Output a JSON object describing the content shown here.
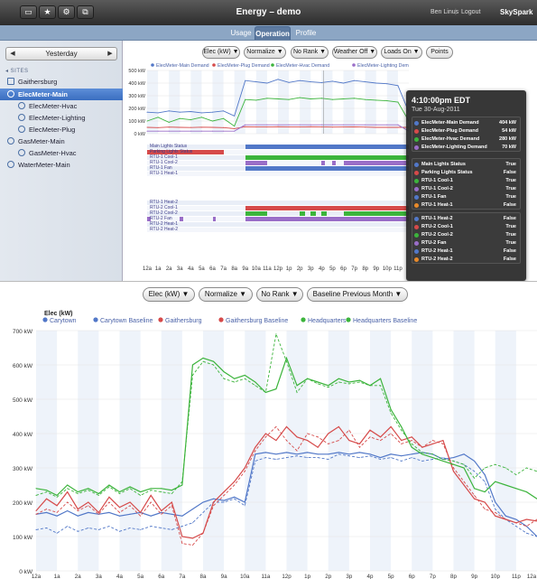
{
  "topbar": {
    "title": "Energy – demo",
    "user": "Ben Linus",
    "separator": "|",
    "logout": "Logout",
    "brand": "SkySpark",
    "icons": [
      "window-icon",
      "star-icon",
      "settings-icon",
      "copy-icon"
    ],
    "glyphs": [
      "▭",
      "★",
      "⚙",
      "⧉"
    ]
  },
  "tabs": [
    {
      "label": "Usage",
      "active": false
    },
    {
      "label": "Operation",
      "active": true
    },
    {
      "label": "Profile",
      "active": false
    }
  ],
  "sidebar": {
    "date": "Yesterday",
    "prev": "◀",
    "next": "▶",
    "sites_header": "◂ SITES",
    "items": [
      {
        "label": "Gaithersburg",
        "kind": "site",
        "level": 0,
        "selected": false
      },
      {
        "label": "ElecMeter-Main",
        "kind": "meter",
        "level": 0,
        "selected": true
      },
      {
        "label": "ElecMeter-Hvac",
        "kind": "meter",
        "level": 1,
        "selected": false
      },
      {
        "label": "ElecMeter-Lighting",
        "kind": "meter",
        "level": 1,
        "selected": false
      },
      {
        "label": "ElecMeter-Plug",
        "kind": "meter",
        "level": 1,
        "selected": false
      },
      {
        "label": "GasMeter-Main",
        "kind": "meter",
        "level": 0,
        "selected": false
      },
      {
        "label": "GasMeter-Hvac",
        "kind": "meter",
        "level": 1,
        "selected": false
      },
      {
        "label": "WaterMeter-Main",
        "kind": "meter",
        "level": 0,
        "selected": false
      }
    ]
  },
  "controls_top": [
    "Elec (kW) ▼",
    "Normalize ▼",
    "No Rank ▼",
    "Weather Off ▼",
    "Loads On ▼",
    "Points"
  ],
  "controls_main": [
    "Elec (kW) ▼",
    "Normalize ▼",
    "No Rank ▼",
    "Baseline Previous Month ▼"
  ],
  "colors": {
    "blue": "#5278c8",
    "red": "#d64a4a",
    "green": "#3cb43c",
    "purple": "#9a6ec8",
    "orange": "#e88a2a",
    "light_blue": "#9ab4e0",
    "light_red": "#e49a9a",
    "light_green": "#9ad89a"
  },
  "time_ticks": [
    "12a",
    "1a",
    "2a",
    "3a",
    "4a",
    "5a",
    "6a",
    "7a",
    "8a",
    "9a",
    "10a",
    "11a",
    "12p",
    "1p",
    "2p",
    "3p",
    "4p",
    "5p",
    "6p",
    "7p",
    "8p",
    "9p",
    "10p",
    "11p",
    "12a"
  ],
  "demand_chart": {
    "legend": [
      "ElecMeter-Main Demand",
      "ElecMeter-Plug Demand",
      "ElecMeter-Hvac Demand",
      "ElecMeter-Lighting Demand"
    ],
    "y_ticks": [
      "500 kW",
      "400 kW",
      "300 kW",
      "200 kW",
      "100 kW",
      "0 kW"
    ]
  },
  "status": {
    "group1": [
      {
        "label": "Main Lights Status",
        "color": "blue",
        "on": [
          [
            9,
            24
          ]
        ]
      },
      {
        "label": "Parking Lights Status",
        "color": "red",
        "on": [
          [
            0,
            7
          ]
        ]
      },
      {
        "label": "RTU-1 Cool-1",
        "color": "green",
        "on": [
          [
            9,
            24
          ]
        ]
      },
      {
        "label": "RTU-1 Cool-2",
        "color": "purple",
        "on": [
          [
            9,
            11
          ],
          [
            16,
            16.3
          ],
          [
            17,
            17.3
          ],
          [
            18,
            24
          ]
        ]
      },
      {
        "label": "RTU-1 Fan",
        "color": "blue",
        "on": [
          [
            9,
            24
          ]
        ]
      },
      {
        "label": "RTU-1 Heat-1",
        "color": "orange",
        "on": []
      }
    ],
    "group2": [
      {
        "label": "RTU-1 Heat-2",
        "color": "blue",
        "on": []
      },
      {
        "label": "RTU-2 Cool-1",
        "color": "red",
        "on": [
          [
            9,
            24
          ]
        ]
      },
      {
        "label": "RTU-2 Cool-2",
        "color": "green",
        "on": [
          [
            9,
            11
          ],
          [
            14,
            14.5
          ],
          [
            15,
            15.5
          ],
          [
            16,
            16.5
          ],
          [
            18,
            24
          ]
        ]
      },
      {
        "label": "RTU-2 Fan",
        "color": "purple",
        "on": [
          [
            0,
            0.3
          ],
          [
            3,
            3.3
          ],
          [
            6,
            6.3
          ],
          [
            9,
            24
          ]
        ]
      },
      {
        "label": "RTU-2 Heat-1",
        "color": "blue",
        "on": []
      },
      {
        "label": "RTU-2 Heat-2",
        "color": "orange",
        "on": []
      }
    ]
  },
  "tooltip": {
    "time": "4:10:00pm EDT",
    "date": "Tue 30-Aug-2011",
    "groups": [
      [
        {
          "label": "ElecMeter-Main Demand",
          "value": "404 kW",
          "color": "blue"
        },
        {
          "label": "ElecMeter-Plug Demand",
          "value": "54 kW",
          "color": "red"
        },
        {
          "label": "ElecMeter-Hvac Demand",
          "value": "280 kW",
          "color": "green"
        },
        {
          "label": "ElecMeter-Lighting Demand",
          "value": "70 kW",
          "color": "purple"
        }
      ],
      [
        {
          "label": "Main Lights Status",
          "value": "True",
          "color": "blue"
        },
        {
          "label": "Parking Lights Status",
          "value": "False",
          "color": "red"
        },
        {
          "label": "RTU-1 Cool-1",
          "value": "True",
          "color": "green"
        },
        {
          "label": "RTU-1 Cool-2",
          "value": "True",
          "color": "purple"
        },
        {
          "label": "RTU-1 Fan",
          "value": "True",
          "color": "blue"
        },
        {
          "label": "RTU-1 Heat-1",
          "value": "False",
          "color": "orange"
        }
      ],
      [
        {
          "label": "RTU-1 Heat-2",
          "value": "False",
          "color": "blue"
        },
        {
          "label": "RTU-2 Cool-1",
          "value": "True",
          "color": "red"
        },
        {
          "label": "RTU-2 Cool-2",
          "value": "True",
          "color": "green"
        },
        {
          "label": "RTU-2 Fan",
          "value": "True",
          "color": "purple"
        },
        {
          "label": "RTU-2 Heat-1",
          "value": "False",
          "color": "blue"
        },
        {
          "label": "RTU-2 Heat-2",
          "value": "False",
          "color": "orange"
        }
      ]
    ]
  },
  "chart_data": [
    {
      "type": "line",
      "legend": [
        "ElecMeter-Main Demand",
        "ElecMeter-Plug Demand",
        "ElecMeter-Hvac Demand",
        "ElecMeter-Lighting Demand"
      ],
      "x_ticks": [
        "12a",
        "1a",
        "2a",
        "3a",
        "4a",
        "5a",
        "6a",
        "7a",
        "8a",
        "9a",
        "10a",
        "11a",
        "12p",
        "1p",
        "2p",
        "3p",
        "4p",
        "5p",
        "6p",
        "7p",
        "8p",
        "9p",
        "10p",
        "11p",
        "12a"
      ],
      "ylim": [
        0,
        500
      ],
      "y_ticks": [
        0,
        100,
        200,
        300,
        400,
        500
      ],
      "x": [
        0,
        1,
        2,
        3,
        4,
        5,
        6,
        7,
        8,
        9,
        10,
        11,
        12,
        13,
        14,
        15,
        16,
        17,
        18,
        19,
        20,
        21,
        22,
        23,
        24
      ],
      "series": [
        {
          "name": "ElecMeter-Main Demand",
          "color": "blue",
          "values": [
            170,
            165,
            180,
            170,
            175,
            165,
            170,
            180,
            140,
            420,
            410,
            400,
            430,
            405,
            420,
            410,
            404,
            415,
            400,
            420,
            410,
            400,
            395,
            380,
            170
          ]
        },
        {
          "name": "ElecMeter-Plug Demand",
          "color": "red",
          "values": [
            50,
            48,
            52,
            50,
            49,
            51,
            50,
            48,
            40,
            55,
            54,
            53,
            55,
            54,
            53,
            55,
            54,
            52,
            53,
            54,
            52,
            50,
            50,
            50,
            50
          ]
        },
        {
          "name": "ElecMeter-Hvac Demand",
          "color": "green",
          "values": [
            100,
            130,
            90,
            120,
            110,
            130,
            100,
            120,
            60,
            270,
            265,
            280,
            275,
            270,
            285,
            275,
            280,
            270,
            275,
            280,
            270,
            265,
            260,
            250,
            100
          ]
        },
        {
          "name": "ElecMeter-Lighting Demand",
          "color": "purple",
          "values": [
            20,
            20,
            20,
            20,
            20,
            20,
            20,
            20,
            20,
            70,
            70,
            70,
            70,
            70,
            70,
            70,
            70,
            70,
            70,
            70,
            70,
            70,
            70,
            70,
            20
          ]
        }
      ]
    },
    {
      "type": "line",
      "title": "Elec (kW)",
      "legend": [
        "Carytown",
        "Carytown Baseline",
        "Gaithersburg",
        "Gaithersburg Baseline",
        "Headquarters",
        "Headquarters Baseline"
      ],
      "x_ticks": [
        "12a",
        "1a",
        "2a",
        "3a",
        "4a",
        "5a",
        "6a",
        "7a",
        "8a",
        "9a",
        "10a",
        "11a",
        "12p",
        "1p",
        "2p",
        "3p",
        "4p",
        "5p",
        "6p",
        "7p",
        "8p",
        "9p",
        "10p",
        "11p",
        "12a"
      ],
      "ylim": [
        0,
        700
      ],
      "y_ticks": [
        "0 kW",
        "100 kW",
        "200 kW",
        "300 kW",
        "400 kW",
        "500 kW",
        "600 kW",
        "700 kW"
      ],
      "x": [
        0,
        0.5,
        1,
        1.5,
        2,
        2.5,
        3,
        3.5,
        4,
        4.5,
        5,
        5.5,
        6,
        6.5,
        7,
        7.5,
        8,
        8.5,
        9,
        9.5,
        10,
        10.5,
        11,
        11.5,
        12,
        12.5,
        13,
        13.5,
        14,
        14.5,
        15,
        15.5,
        16,
        16.5,
        17,
        17.5,
        18,
        18.5,
        19,
        19.5,
        20,
        20.5,
        21,
        21.5,
        22,
        22.5,
        23,
        23.5,
        24
      ],
      "series": [
        {
          "name": "Carytown",
          "color": "blue",
          "dashed": false,
          "values": [
            165,
            170,
            160,
            175,
            160,
            170,
            165,
            170,
            160,
            165,
            170,
            160,
            170,
            165,
            160,
            180,
            200,
            210,
            205,
            215,
            200,
            340,
            345,
            340,
            345,
            340,
            345,
            340,
            340,
            345,
            340,
            345,
            340,
            330,
            340,
            335,
            340,
            345,
            340,
            325,
            330,
            340,
            320,
            280,
            200,
            160,
            150,
            130,
            100
          ]
        },
        {
          "name": "Carytown Baseline",
          "color": "blue",
          "dashed": true,
          "values": [
            120,
            125,
            110,
            130,
            115,
            125,
            120,
            130,
            115,
            125,
            120,
            130,
            125,
            120,
            130,
            140,
            170,
            200,
            200,
            210,
            190,
            320,
            330,
            325,
            330,
            335,
            330,
            330,
            325,
            340,
            335,
            330,
            335,
            325,
            330,
            320,
            330,
            320,
            325,
            330,
            320,
            310,
            290,
            260,
            180,
            150,
            130,
            110,
            100
          ]
        },
        {
          "name": "Gaithersburg",
          "color": "red",
          "dashed": false,
          "values": [
            175,
            210,
            190,
            230,
            180,
            200,
            170,
            215,
            185,
            200,
            170,
            220,
            175,
            200,
            100,
            95,
            110,
            200,
            230,
            260,
            300,
            360,
            400,
            380,
            420,
            390,
            380,
            360,
            400,
            420,
            380,
            370,
            410,
            390,
            420,
            380,
            390,
            360,
            370,
            380,
            290,
            250,
            210,
            200,
            160,
            150,
            140,
            150,
            145
          ]
        },
        {
          "name": "Gaithersburg Baseline",
          "color": "red",
          "dashed": true,
          "values": [
            165,
            180,
            170,
            200,
            175,
            190,
            165,
            200,
            170,
            190,
            160,
            200,
            165,
            190,
            80,
            75,
            110,
            190,
            220,
            250,
            290,
            350,
            390,
            420,
            380,
            350,
            400,
            390,
            370,
            380,
            410,
            360,
            390,
            380,
            400,
            370,
            380,
            360,
            380,
            370,
            300,
            260,
            220,
            180,
            170,
            150,
            140,
            130,
            150
          ]
        },
        {
          "name": "Headquarters",
          "color": "green",
          "dashed": false,
          "values": [
            240,
            235,
            220,
            250,
            230,
            240,
            225,
            250,
            230,
            245,
            230,
            240,
            240,
            235,
            250,
            600,
            620,
            610,
            580,
            560,
            570,
            550,
            520,
            530,
            620,
            540,
            560,
            550,
            540,
            560,
            550,
            555,
            540,
            560,
            470,
            420,
            360,
            340,
            330,
            320,
            310,
            300,
            240,
            230,
            260,
            250,
            240,
            230,
            210
          ]
        },
        {
          "name": "Headquarters Baseline",
          "color": "green",
          "dashed": true,
          "values": [
            220,
            230,
            215,
            240,
            225,
            235,
            220,
            245,
            225,
            240,
            220,
            235,
            230,
            225,
            260,
            570,
            610,
            600,
            560,
            550,
            560,
            540,
            520,
            690,
            610,
            520,
            560,
            545,
            535,
            550,
            545,
            550,
            540,
            540,
            460,
            410,
            370,
            345,
            340,
            325,
            320,
            310,
            270,
            300,
            310,
            300,
            280,
            300,
            290
          ]
        }
      ]
    }
  ]
}
